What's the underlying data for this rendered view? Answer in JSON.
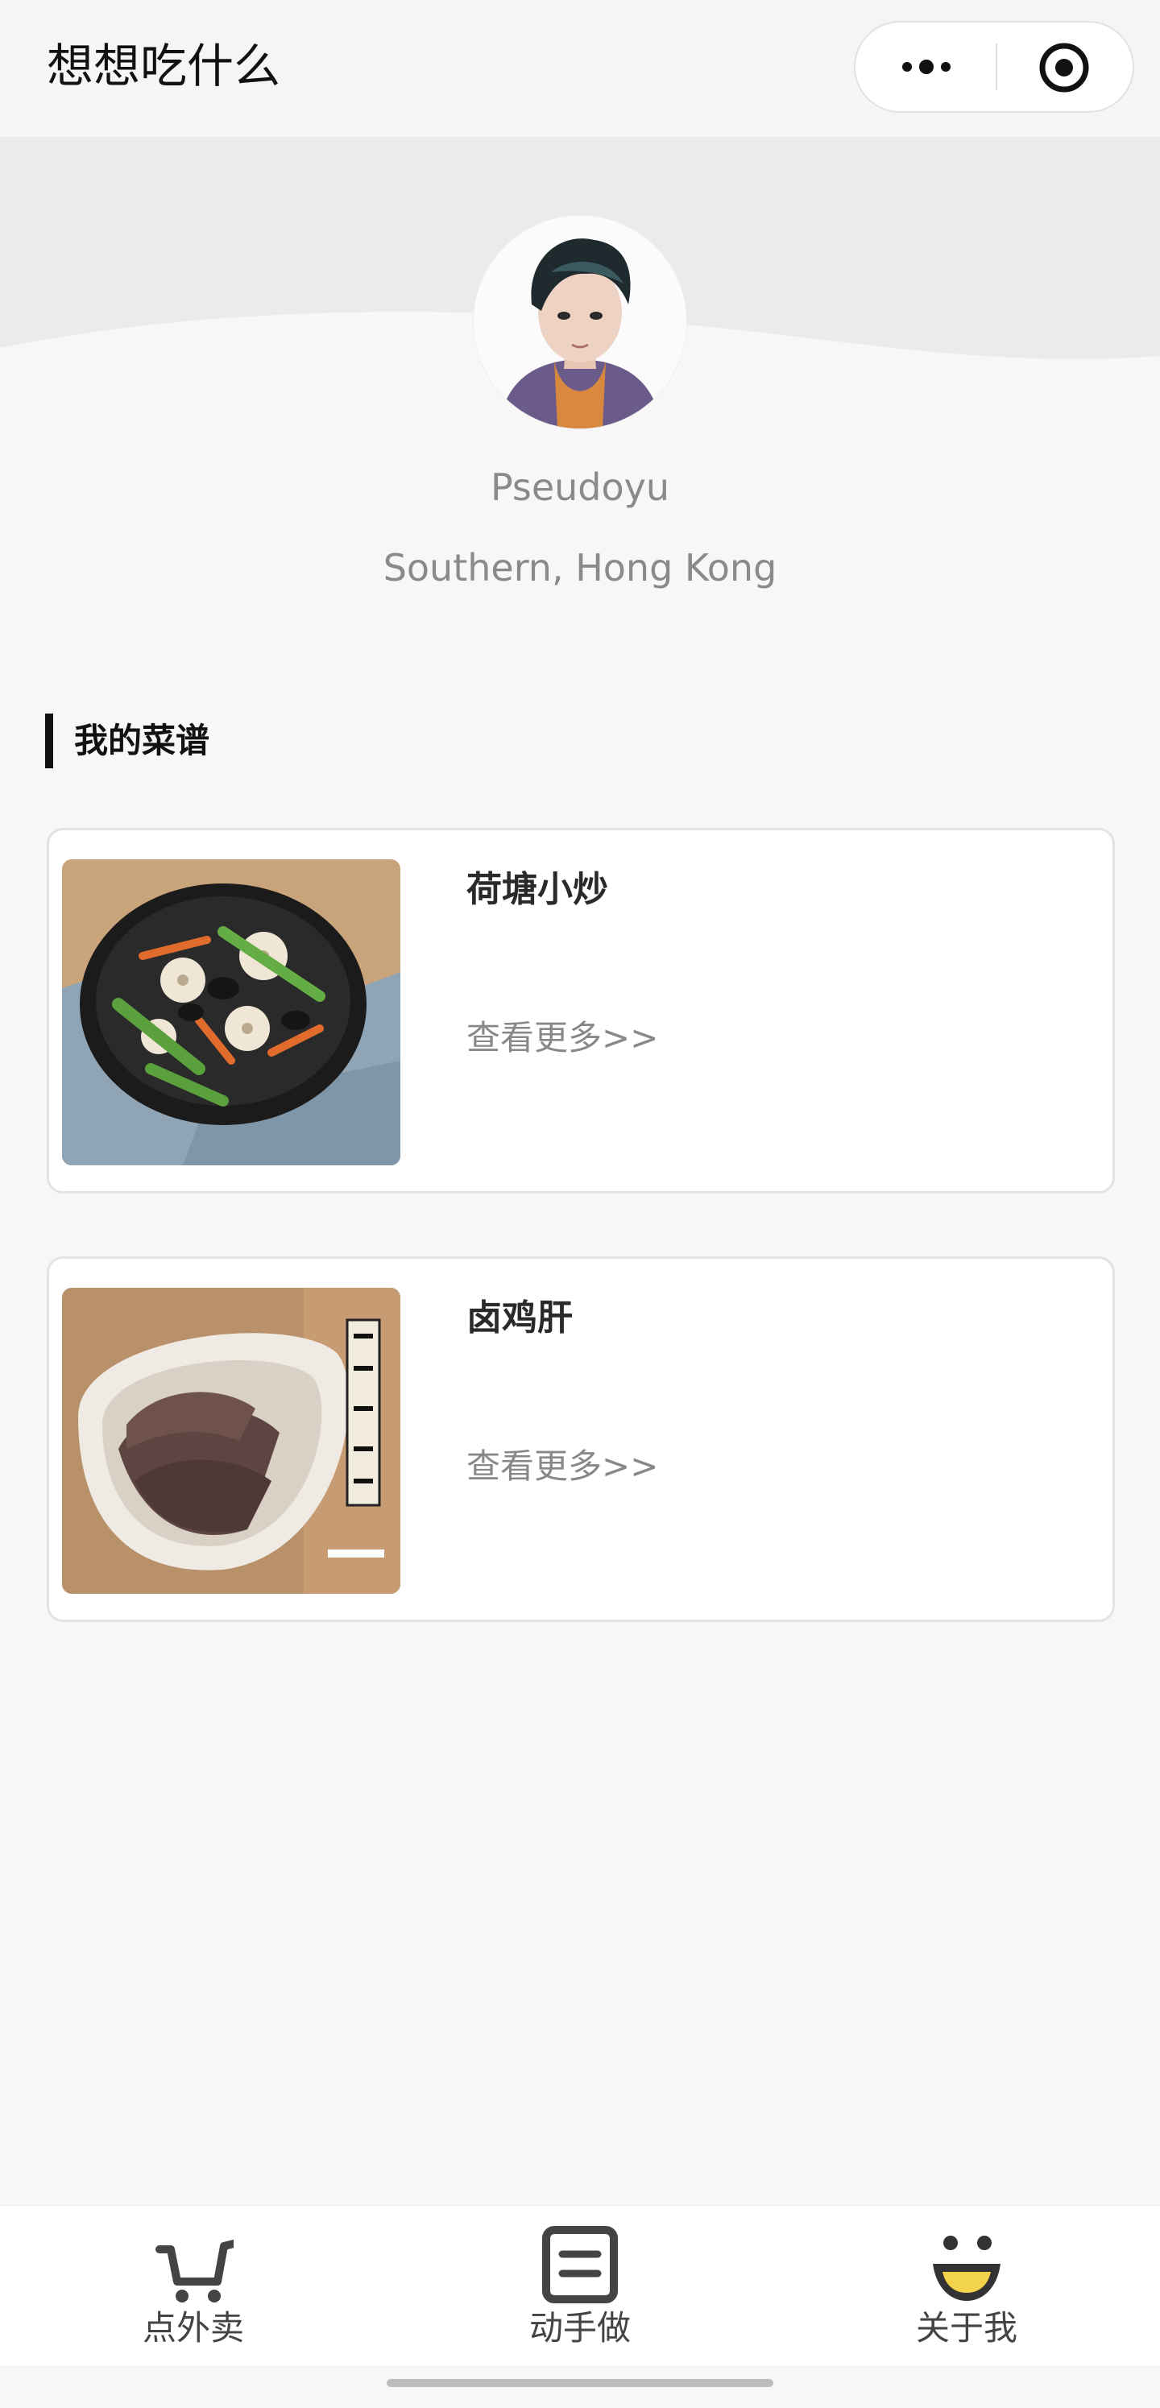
{
  "navbar": {
    "title": "想想吃什么",
    "more_icon": "more-dots-icon",
    "close_icon": "target-circle-icon"
  },
  "profile": {
    "name": "Pseudoyu",
    "location": "Southern, Hong Kong",
    "avatar_icon": "user-portrait-avatar"
  },
  "section": {
    "title": "我的菜谱"
  },
  "recipes": [
    {
      "title": "荷塘小炒",
      "more_label": "查看更多>>",
      "image": "lotus-stir-fry-photo"
    },
    {
      "title": "卤鸡肝",
      "more_label": "查看更多>>",
      "image": "braised-chicken-liver-photo"
    }
  ],
  "tabbar": {
    "items": [
      {
        "label": "点外卖",
        "icon": "cart-icon"
      },
      {
        "label": "动手做",
        "icon": "document-icon"
      },
      {
        "label": "关于我",
        "icon": "smile-face-icon"
      }
    ]
  },
  "colors": {
    "background": "#f7f7f7",
    "card": "#ffffff",
    "accent_yellow": "#f3d34a",
    "muted_text": "#8a8a8a"
  }
}
